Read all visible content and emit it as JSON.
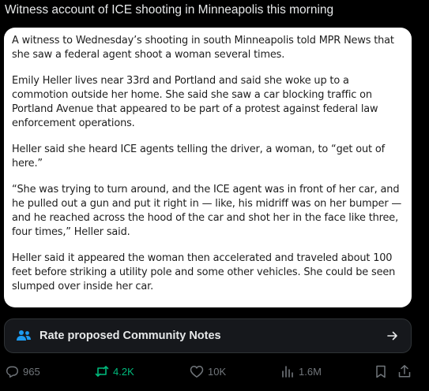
{
  "post": {
    "title": "Witness account of ICE shooting in Minneapolis this morning"
  },
  "article": {
    "paragraphs": [
      "A witness to Wednesday’s shooting in south Minneapolis told MPR News that she saw a federal agent shoot a woman several times.",
      "Emily Heller lives near 33rd and Portland and said she woke up to a commotion outside her home. She said she saw a car blocking traffic on Portland Avenue that appeared to be part of a protest against federal law enforcement operations.",
      "Heller said she heard ICE agents telling the driver, a woman, to “get out of here.”",
      "“She was trying to turn around, and the ICE agent was in front of her car, and he pulled out a gun and put it right in — like, his midriff was on her bumper — and he reached across the hood of the car and shot her in the face like three, four times,” Heller said.",
      "Heller said it appeared the woman then accelerated and traveled about 100 feet before striking a utility pole and some other vehicles. She could be seen slumped over inside her car."
    ]
  },
  "community_notes": {
    "label": "Rate proposed Community Notes",
    "icon": "people-icon",
    "arrow_icon": "arrow-right-icon"
  },
  "actions": {
    "replies": {
      "count": "965",
      "icon": "reply-icon"
    },
    "reposts": {
      "count": "4.2K",
      "icon": "repost-icon"
    },
    "likes": {
      "count": "10K",
      "icon": "heart-icon"
    },
    "views": {
      "count": "1.6M",
      "icon": "views-icon"
    },
    "bookmark": {
      "icon": "bookmark-icon"
    },
    "share": {
      "icon": "share-icon"
    }
  },
  "colors": {
    "background": "#000000",
    "text": "#e7e9ea",
    "muted": "#71767b",
    "repost_active": "#00ba7c",
    "notes_icon": "#1d9bf0"
  }
}
